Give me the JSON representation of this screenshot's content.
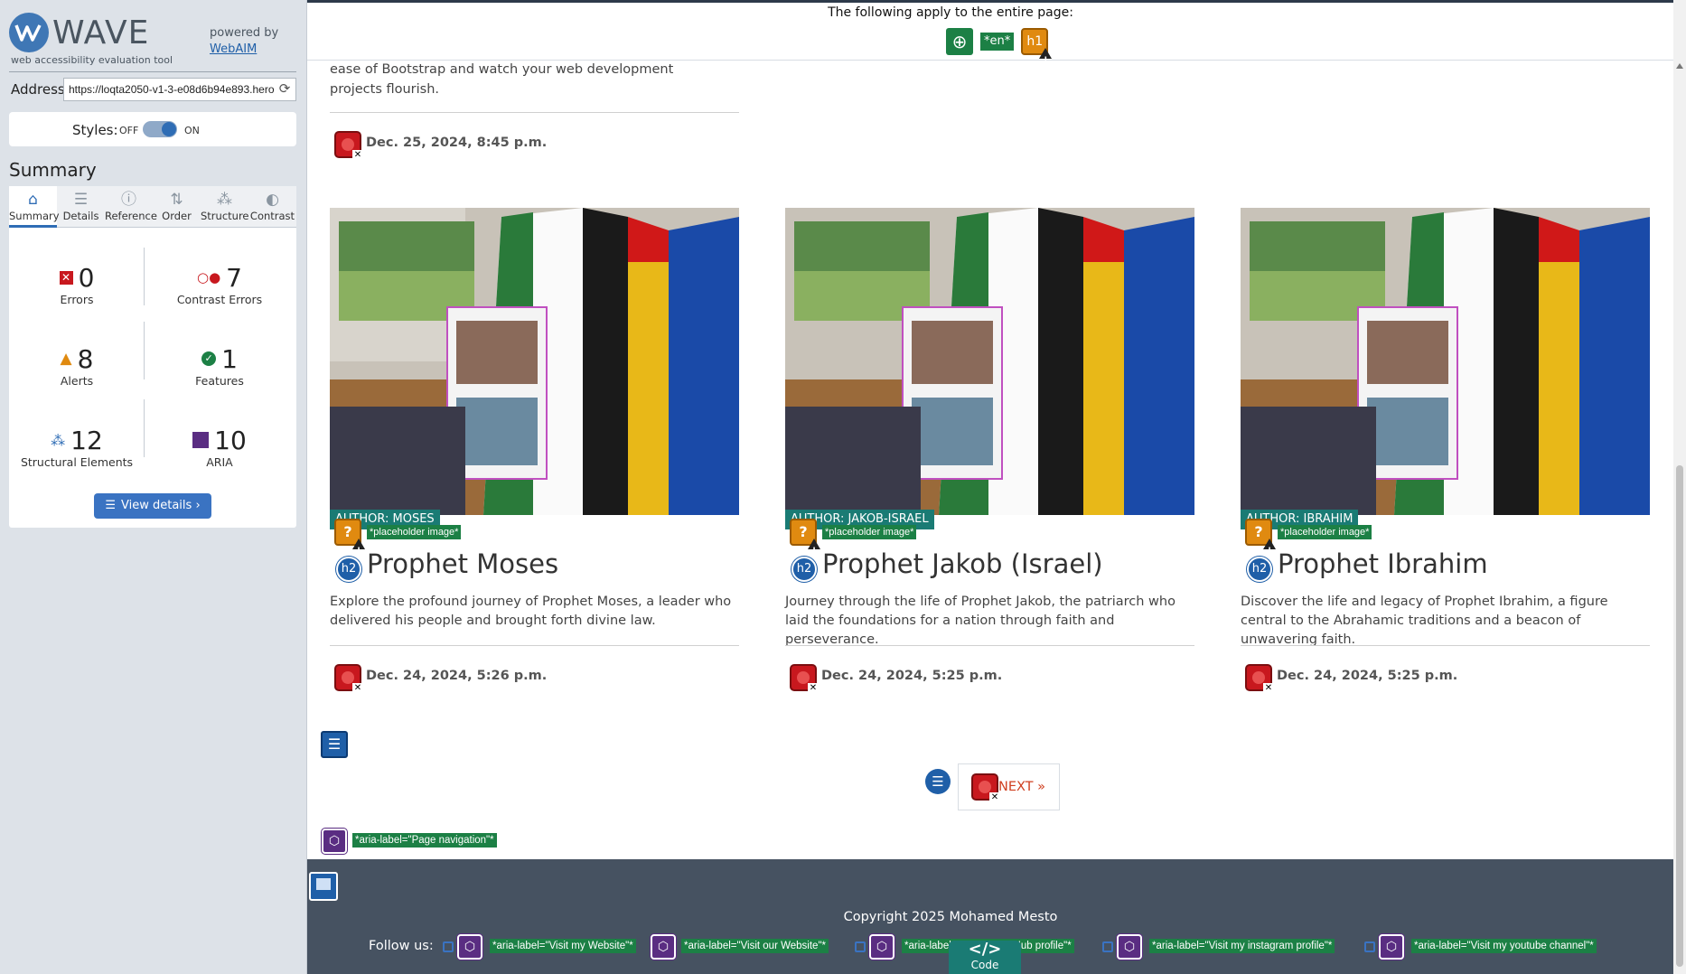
{
  "sidebar": {
    "logo_text": "WAVE",
    "logo_sub": "web accessibility evaluation tool",
    "powered_by": "powered by",
    "webaim_link": "WebAIM",
    "address_label": "Address:",
    "address_value": "https://loqta2050-v1-3-e08d6b94e893.hero",
    "styles_label": "Styles:",
    "styles_off": "OFF",
    "styles_on": "ON",
    "summary_heading": "Summary",
    "tabs": [
      {
        "label": "Summary",
        "icon": "home-icon",
        "active": true
      },
      {
        "label": "Details",
        "icon": "list-icon"
      },
      {
        "label": "Reference",
        "icon": "info-icon"
      },
      {
        "label": "Order",
        "icon": "order-icon"
      },
      {
        "label": "Structure",
        "icon": "structure-icon"
      },
      {
        "label": "Contrast",
        "icon": "contrast-icon"
      }
    ],
    "stats": {
      "errors": {
        "value": "0",
        "label": "Errors"
      },
      "contrast_errors": {
        "value": "7",
        "label": "Contrast Errors"
      },
      "alerts": {
        "value": "8",
        "label": "Alerts"
      },
      "features": {
        "value": "1",
        "label": "Features"
      },
      "structural": {
        "value": "12",
        "label": "Structural Elements"
      },
      "aria": {
        "value": "10",
        "label": "ARIA"
      }
    },
    "view_details": "View details ›"
  },
  "main": {
    "apply_text": "The following apply to the entire page:",
    "apply_icons": {
      "lang": "*en*",
      "h1": "h1"
    },
    "top_desc": "ease of Bootstrap and watch your web development projects flourish.",
    "top_date": "Dec. 25, 2024, 8:45 p.m.",
    "placeholder_label": "*placeholder image*",
    "h2_label": "h2",
    "cards": [
      {
        "author": "AUTHOR: MOSES",
        "title": "Prophet Moses",
        "desc": "Explore the profound journey of Prophet Moses, a leader who delivered his people and brought forth divine law.",
        "date": "Dec. 24, 2024, 5:26 p.m."
      },
      {
        "author": "AUTHOR: JAKOB-ISRAEL",
        "title": "Prophet Jakob (Israel)",
        "desc": "Journey through the life of Prophet Jakob, the patriarch who laid the foundations for a nation through faith and perseverance.",
        "date": "Dec. 24, 2024, 5:25 p.m."
      },
      {
        "author": "AUTHOR: IBRAHIM",
        "title": "Prophet Ibrahim",
        "desc": "Discover the life and legacy of Prophet Ibrahim, a figure central to the Abrahamic traditions and a beacon of unwavering faith.",
        "date": "Dec. 24, 2024, 5:25 p.m."
      }
    ],
    "next_label": "NEXT »",
    "page_nav_label": "*aria-label=\"Page navigation\"*"
  },
  "footer": {
    "copyright": "Copyright 2025 Mohamed Mesto",
    "follow_label": "Follow us:",
    "aria_labels": [
      "*aria-label=\"Visit my Website\"*",
      "*aria-label=\"Visit our Website\"*",
      "*aria-label=\"Visit my GitHub profile\"*",
      "*aria-label=\"Visit my instagram profile\"*",
      "*aria-label=\"Visit my youtube channel\"*"
    ],
    "code_symbol": "</>",
    "code_label": "Code"
  },
  "colors": {
    "accent_blue": "#2f6db5",
    "error_red": "#c8181e",
    "alert_orange": "#e08a10",
    "feature_green": "#1c8045",
    "aria_purple": "#5a2d82",
    "footer_bg": "#465261"
  }
}
